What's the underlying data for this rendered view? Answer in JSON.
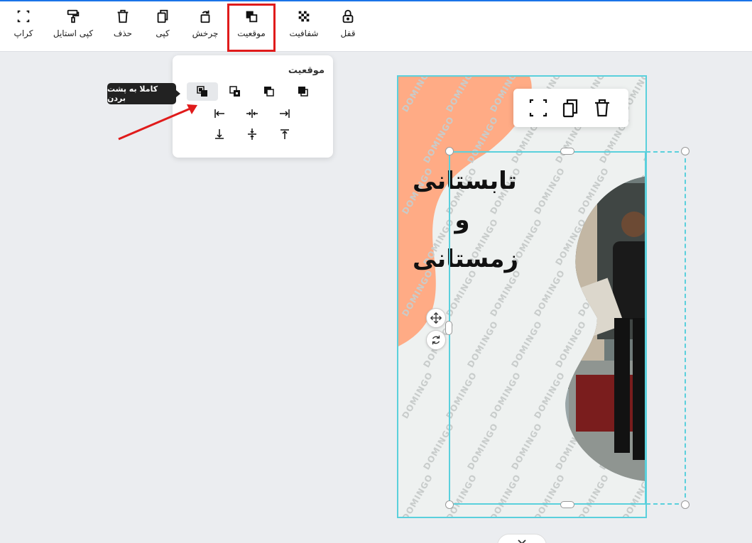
{
  "toolbar": {
    "items": [
      {
        "label": "قفل",
        "icon": "lock-icon"
      },
      {
        "label": "شفافیت",
        "icon": "transparency-icon"
      },
      {
        "label": "موقعیت",
        "icon": "position-icon",
        "active": true
      },
      {
        "label": "چرخش",
        "icon": "rotate-icon"
      },
      {
        "label": "کپی",
        "icon": "copy-icon"
      },
      {
        "label": "حذف",
        "icon": "trash-icon"
      },
      {
        "label": "کپی استایل",
        "icon": "paint-roller-icon"
      },
      {
        "label": "کراپ",
        "icon": "crop-icon"
      }
    ]
  },
  "position_popup": {
    "title": "موقعیت",
    "tooltip": "کاملا به پشت بردن"
  },
  "design": {
    "headline_line1": "تابستانی",
    "headline_line2": "و",
    "headline_line3": "زمستانی",
    "watermark": "DOMINGO"
  },
  "colors": {
    "accent_selection": "#5ad0dc",
    "annotation_red": "#e01b1b",
    "peach_shape": "#ffab85"
  }
}
